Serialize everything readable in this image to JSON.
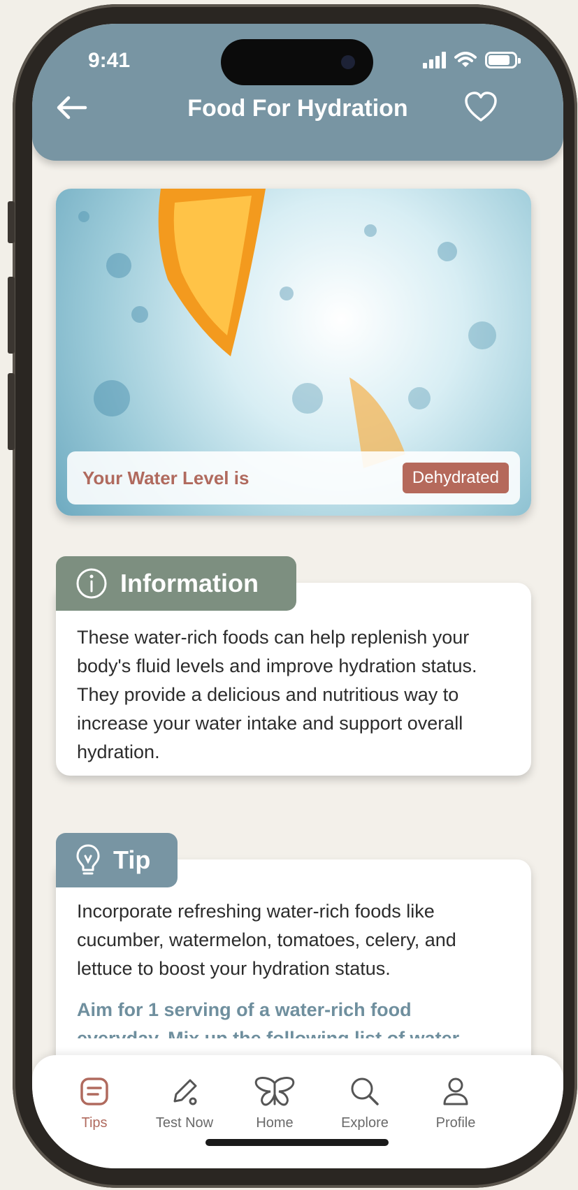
{
  "status_bar": {
    "time": "9:41"
  },
  "header": {
    "title": "Food For Hydration"
  },
  "hero": {
    "water_level_label": "Your Water Level is",
    "water_status": "Dehydrated"
  },
  "information": {
    "title": "Information",
    "body": "These water-rich foods can help replenish your body's fluid levels and improve hydration status. They provide a delicious and nutritious way to increase your water intake and support overall hydration."
  },
  "tip": {
    "title": "Tip",
    "body": "Incorporate refreshing water-rich foods like cucumber, watermelon, tomatoes, celery, and lettuce to boost your hydration status.",
    "aim": "Aim for 1 serving of a water-rich food",
    "aim_continued": "everyday. Mix up the following list of water"
  },
  "nav": {
    "items": [
      {
        "label": "Tips",
        "icon": "tips-icon"
      },
      {
        "label": "Test Now",
        "icon": "pen-icon"
      },
      {
        "label": "Home",
        "icon": "butterfly-icon"
      },
      {
        "label": "Explore",
        "icon": "search-icon"
      },
      {
        "label": "Profile",
        "icon": "profile-icon"
      }
    ],
    "active_index": 0
  },
  "colors": {
    "header": "#7895a3",
    "accent": "#b5695b",
    "info_tab": "#7d8f80",
    "tip_tab": "#7895a3",
    "background": "#f3f0ea"
  }
}
